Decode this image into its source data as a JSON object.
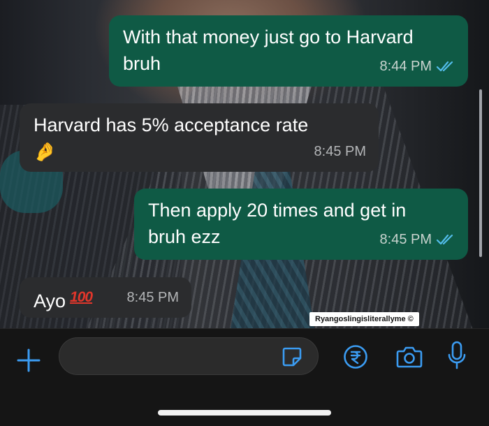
{
  "messages": [
    {
      "direction": "out",
      "text": "With that money just go to Harvard\nbruh",
      "time": "8:44 PM",
      "status": "read"
    },
    {
      "direction": "in",
      "text": "Harvard has 5% acceptance rate",
      "emoji": "🤌",
      "time": "8:45 PM"
    },
    {
      "direction": "out",
      "text": "Then apply 20 times and get in\nbruh ezz",
      "time": "8:45 PM",
      "status": "read"
    },
    {
      "direction": "in",
      "text": "Ayo",
      "emoji": "100",
      "time": "8:45 PM"
    }
  ],
  "watermark": "Ryangoslingisliterallyme ©",
  "composer": {
    "input_value": "",
    "icons": [
      "plus-icon",
      "sticker-icon",
      "rupee-icon",
      "camera-icon",
      "mic-icon"
    ]
  },
  "colors": {
    "outgoing_bubble": "#0f5a45",
    "incoming_bubble": "#2b2c2e",
    "accent_blue": "#3b9cf2",
    "read_ticks": "#53bdeb",
    "hundred_emoji": "#e2362b"
  }
}
